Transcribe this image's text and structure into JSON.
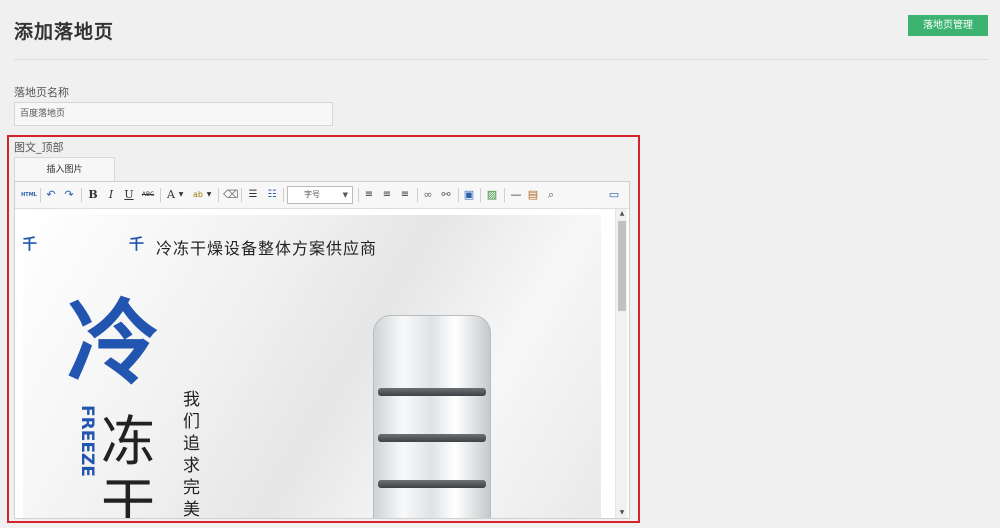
{
  "page": {
    "title": "添加落地页",
    "manage_button": "落地页管理"
  },
  "form": {
    "name_label": "落地页名称",
    "name_value": "百度落地页",
    "section_label": "图文_顶部",
    "insert_image_tab": "插入图片"
  },
  "toolbar": {
    "html_label": "HTML",
    "bold": "B",
    "italic": "I",
    "underline": "U",
    "strike": "ABC",
    "font_color": "A",
    "bg_color": "ab",
    "fontsize_placeholder": "字号",
    "icons": [
      "html-icon",
      "undo-icon",
      "redo-icon",
      "bold-icon",
      "italic-icon",
      "underline-icon",
      "strikethrough-icon",
      "font-color-icon",
      "highlight-icon",
      "eraser-icon",
      "ordered-list-icon",
      "unordered-list-icon",
      "fontsize-select",
      "align-left-icon",
      "align-center-icon",
      "align-right-icon",
      "link-icon",
      "unlink-icon",
      "save-icon",
      "image-icon",
      "hr-icon",
      "paste-icon",
      "zoom-icon",
      "fullscreen-icon"
    ]
  },
  "content": {
    "tagline": "冷冻干燥设备整体方案供应商",
    "logo_left": "千",
    "logo_right": "千",
    "big_char": "冷",
    "chars": [
      "冻",
      "干"
    ],
    "vertical_text": "我们追求完美的",
    "vertical_en": "FREEZE"
  },
  "colors": {
    "accent_green": "#3cb371",
    "highlight_red": "#d4232b",
    "brand_blue": "#2155b0"
  }
}
